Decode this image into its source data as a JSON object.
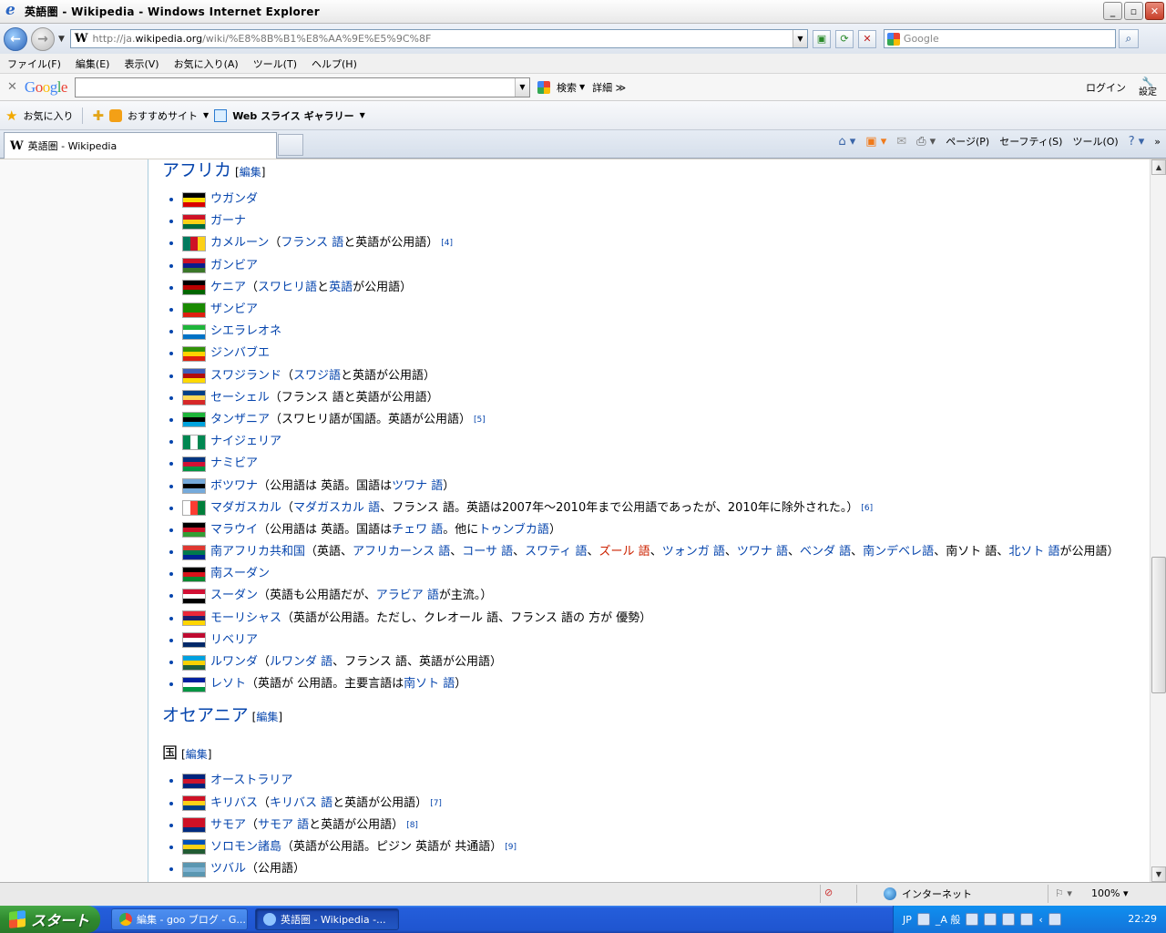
{
  "window": {
    "title": "英語圏 - Wikipedia - Windows Internet Explorer",
    "buttons": {
      "minimize": "_",
      "maximize": "▫",
      "close": "✕"
    }
  },
  "address": {
    "url_prefix": "http://ja.",
    "url_domain": "wikipedia.org",
    "url_rest": "/wiki/%E8%8B%B1%E8%AA%9E%E5%9C%8F",
    "search_placeholder": "Google"
  },
  "menu": [
    "ファイル(F)",
    "編集(E)",
    "表示(V)",
    "お気に入り(A)",
    "ツール(T)",
    "ヘルプ(H)"
  ],
  "google_toolbar": {
    "logo": [
      "G",
      "o",
      "o",
      "g",
      "l",
      "e"
    ],
    "search_label": "検索",
    "more_label": "詳細 ≫",
    "login_label": "ログイン",
    "settings_label": "設定"
  },
  "favorites": {
    "favorites_label": "お気に入り",
    "suggested_label": "おすすめサイト",
    "slice_label": "Web スライス ギャラリー"
  },
  "tab": {
    "title": "英語圏 - Wikipedia"
  },
  "commands": {
    "page": "ページ(P)",
    "safety": "セーフティ(S)",
    "tools": "ツール(O)"
  },
  "article": {
    "edit_label": "編集",
    "africa_heading": "アフリカ",
    "oceania_heading": "オセアニア",
    "countries_subheading": "国",
    "africa": [
      {
        "name": "ウガンダ",
        "flag": [
          "#000000",
          "#fcdc04",
          "#d90000"
        ],
        "note": ""
      },
      {
        "name": "ガーナ",
        "flag": [
          "#ce1126",
          "#fcd116",
          "#006b3f"
        ],
        "note": ""
      },
      {
        "name": "カメルーン",
        "flag": [
          "#007a5e",
          "#ce1126",
          "#fcd116"
        ],
        "vertical": true,
        "note": "（",
        "links": [
          [
            "フランス 語",
            "lnk"
          ],
          [
            "と英語が公用語）",
            ""
          ]
        ],
        "sup": "[4]"
      },
      {
        "name": "ガンビア",
        "flag": [
          "#ce1126",
          "#0c1c8c",
          "#3a7728"
        ],
        "note": ""
      },
      {
        "name": "ケニア",
        "flag": [
          "#000000",
          "#bb0000",
          "#006600"
        ],
        "note": "（",
        "links": [
          [
            "スワヒリ語",
            "lnk"
          ],
          [
            "と",
            ""
          ],
          [
            "英語",
            "lnk"
          ],
          [
            "が公用語）",
            ""
          ]
        ]
      },
      {
        "name": "ザンビア",
        "flag": [
          "#198a00",
          "#198a00",
          "#de2010"
        ],
        "note": ""
      },
      {
        "name": "シエラレオネ",
        "flag": [
          "#1eb53a",
          "#ffffff",
          "#0072c6"
        ],
        "note": ""
      },
      {
        "name": "ジンバブエ",
        "flag": [
          "#319208",
          "#ffd200",
          "#de2010"
        ],
        "note": ""
      },
      {
        "name": "スワジランド",
        "flag": [
          "#3e5eb9",
          "#b10c0c",
          "#ffd900"
        ],
        "note": "（",
        "links": [
          [
            "スワジ語",
            "lnk"
          ],
          [
            "と英語が公用語）",
            ""
          ]
        ]
      },
      {
        "name": "セーシェル",
        "flag": [
          "#003f87",
          "#fcd856",
          "#d62828"
        ],
        "note": "（フランス 語と英語が公用語）"
      },
      {
        "name": "タンザニア",
        "flag": [
          "#1eb53a",
          "#000000",
          "#00a3dd"
        ],
        "note": "（スワヒリ語が国語。英語が公用語）",
        "sup": "[5]"
      },
      {
        "name": "ナイジェリア",
        "flag": [
          "#008751",
          "#ffffff",
          "#008751"
        ],
        "vertical": true,
        "note": ""
      },
      {
        "name": "ナミビア",
        "flag": [
          "#003580",
          "#d21034",
          "#009543"
        ],
        "note": ""
      },
      {
        "name": "ボツワナ",
        "flag": [
          "#75aadb",
          "#000000",
          "#75aadb"
        ],
        "note": "（公用語は 英語。国語は",
        "links": [
          [
            "ツワナ 語",
            "lnk"
          ],
          [
            "）",
            ""
          ]
        ]
      },
      {
        "name": "マダガスカル",
        "flag": [
          "#ffffff",
          "#fc3d32",
          "#007e3a"
        ],
        "vertical": true,
        "note": "（",
        "links": [
          [
            "マダガスカル 語",
            "lnk"
          ],
          [
            "、フランス 語。英語は2007年～2010年まで公用語であったが、2010年に除外された。）",
            ""
          ]
        ],
        "sup": "[6]"
      },
      {
        "name": "マラウイ",
        "flag": [
          "#000000",
          "#ce1126",
          "#339e35"
        ],
        "note": "（公用語は 英語。国語は",
        "links": [
          [
            "チェワ 語",
            "lnk"
          ],
          [
            "。他に",
            ""
          ],
          [
            "トゥンブカ語",
            "lnk"
          ],
          [
            "）",
            ""
          ]
        ]
      },
      {
        "name": "南アフリカ共和国",
        "flag": [
          "#de3831",
          "#007a4d",
          "#002395"
        ],
        "note": "（英語、",
        "links": [
          [
            "アフリカーンス 語",
            "lnk"
          ],
          [
            "、",
            ""
          ],
          [
            "コーサ 語",
            "lnk"
          ],
          [
            "、",
            ""
          ],
          [
            "スワティ 語",
            "lnk"
          ],
          [
            "、",
            ""
          ],
          [
            "ズール 語",
            "new"
          ],
          [
            "、",
            ""
          ],
          [
            "ツォンガ 語",
            "lnk"
          ],
          [
            "、",
            ""
          ],
          [
            "ツワナ 語",
            "lnk"
          ],
          [
            "、",
            ""
          ],
          [
            "ベンダ 語",
            "lnk"
          ],
          [
            "、",
            ""
          ],
          [
            "南ンデベレ語",
            "lnk"
          ],
          [
            "、南ソト 語、",
            ""
          ],
          [
            "北ソト 語",
            "lnk"
          ],
          [
            "が公用語）",
            ""
          ]
        ]
      },
      {
        "name": "南スーダン",
        "flag": [
          "#000000",
          "#da121a",
          "#078930"
        ],
        "note": ""
      },
      {
        "name": "スーダン",
        "flag": [
          "#d21034",
          "#ffffff",
          "#000000"
        ],
        "note": "（英語も公用語だが、",
        "links": [
          [
            "アラビア 語",
            "lnk"
          ],
          [
            "が主流。）",
            ""
          ]
        ]
      },
      {
        "name": "モーリシャス",
        "flag": [
          "#ea2839",
          "#1a206d",
          "#ffd500"
        ],
        "note": "（英語が公用語。ただし、クレオール 語、フランス 語の 方が 優勢）"
      },
      {
        "name": "リベリア",
        "flag": [
          "#bf0a30",
          "#ffffff",
          "#002868"
        ],
        "note": ""
      },
      {
        "name": "ルワンダ",
        "flag": [
          "#00a1de",
          "#fad201",
          "#20603d"
        ],
        "note": "（",
        "links": [
          [
            "ルワンダ 語",
            "lnk"
          ],
          [
            "、フランス 語、英語が公用語）",
            ""
          ]
        ]
      },
      {
        "name": "レソト",
        "flag": [
          "#00209f",
          "#ffffff",
          "#009543"
        ],
        "note": "（英語が 公用語。主要言語は",
        "links": [
          [
            "南ソト 語",
            "lnk"
          ],
          [
            "）",
            ""
          ]
        ]
      }
    ],
    "oceania": [
      {
        "name": "オーストラリア",
        "flag": [
          "#00247d",
          "#cf142b",
          "#00247d"
        ],
        "note": ""
      },
      {
        "name": "キリバス",
        "flag": [
          "#ce1126",
          "#fcd116",
          "#003f87"
        ],
        "note": "（",
        "links": [
          [
            "キリバス 語",
            "lnk"
          ],
          [
            "と英語が公用語）",
            ""
          ]
        ],
        "sup": "[7]"
      },
      {
        "name": "サモア",
        "flag": [
          "#ce1126",
          "#ce1126",
          "#002b7f"
        ],
        "note": "（",
        "links": [
          [
            "サモア 語",
            "lnk"
          ],
          [
            "と英語が公用語）",
            ""
          ]
        ],
        "sup": "[8]"
      },
      {
        "name": "ソロモン諸島",
        "flag": [
          "#0051ba",
          "#fcd116",
          "#215b33"
        ],
        "note": "（英語が公用語。ピジン 英語が 共通語）",
        "sup": "[9]"
      },
      {
        "name": "ツバル",
        "flag": [
          "#5b97b1",
          "#7fb3d1",
          "#5b97b1"
        ],
        "note": "（公用語）"
      }
    ]
  },
  "status": {
    "zone": "インターネット",
    "zoom": "100%"
  },
  "taskbar": {
    "start": "スタート",
    "tasks": [
      "編集 - goo ブログ - G...",
      "英語圏 - Wikipedia -..."
    ],
    "lang": "JP",
    "ime": "_A 般",
    "clock": "22:29"
  }
}
